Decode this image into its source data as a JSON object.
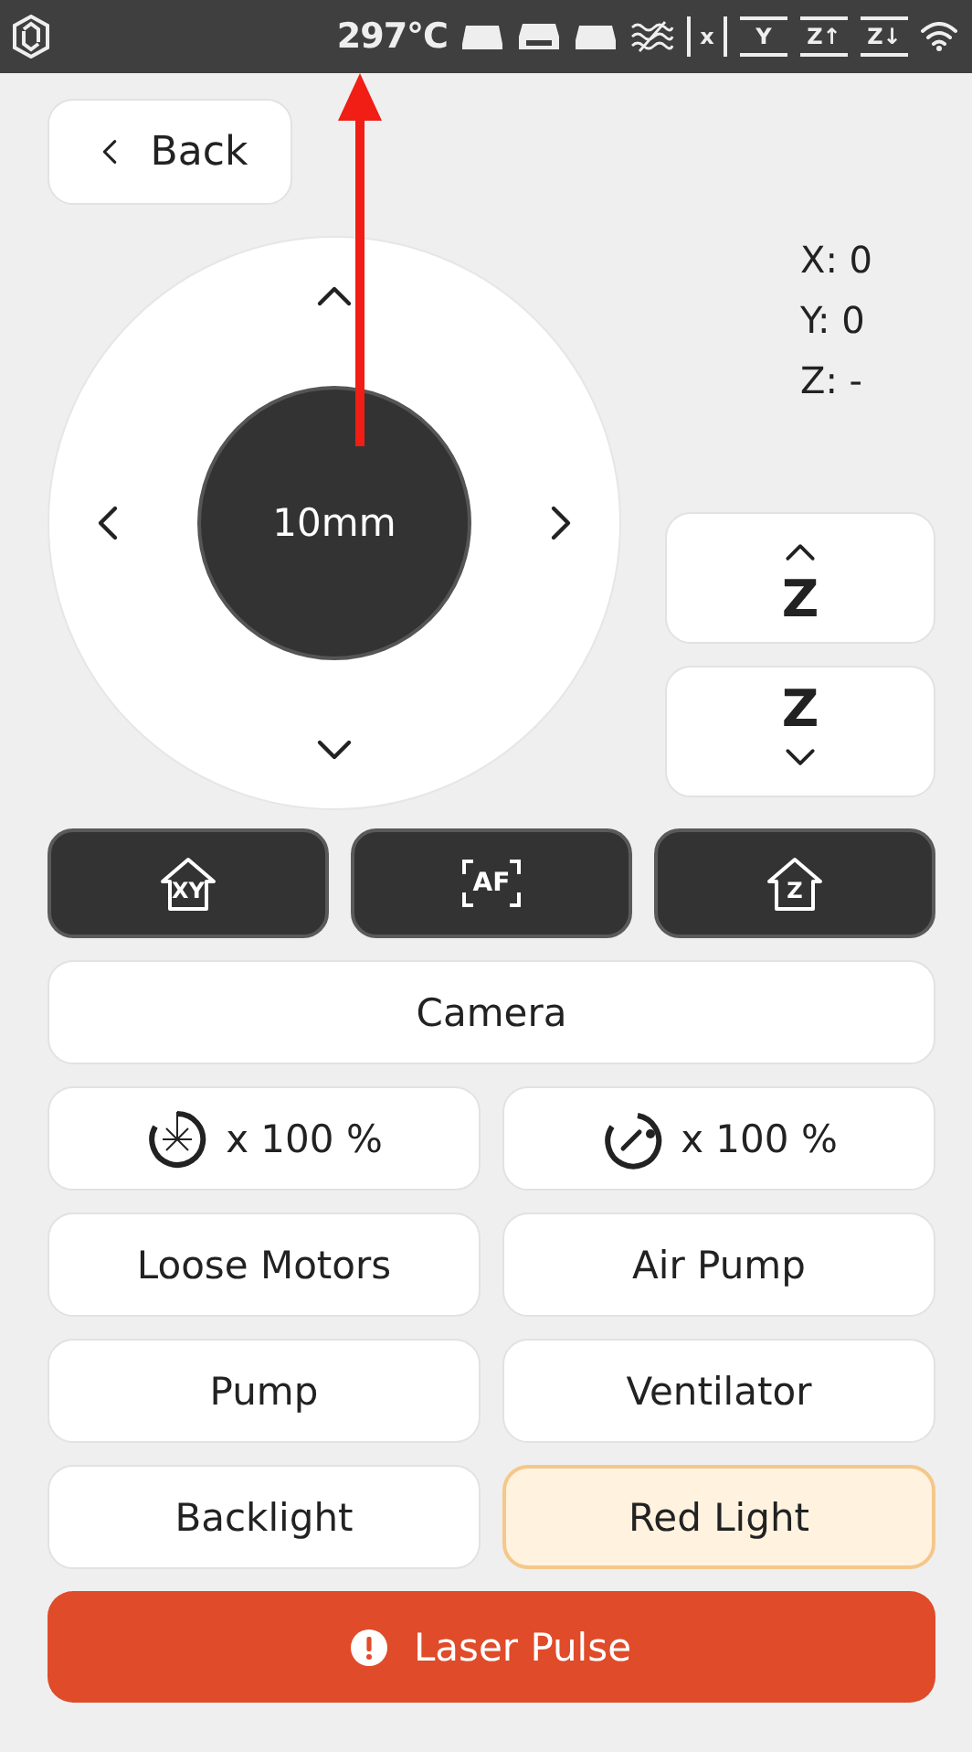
{
  "status_bar": {
    "temperature": "297°C",
    "axis_indicators": [
      {
        "label": "x",
        "kind": "bars"
      },
      {
        "label": "Y",
        "kind": "lines"
      },
      {
        "label": "Z↑",
        "kind": "lines"
      },
      {
        "label": "Z↓",
        "kind": "lines"
      }
    ]
  },
  "back_button": {
    "label": "Back"
  },
  "jog": {
    "step": "10mm"
  },
  "coordinates": [
    "X: 0",
    "Y: 0",
    "Z: -"
  ],
  "z_buttons": [
    {
      "label": "Z",
      "kind": "up"
    },
    {
      "label": "Z",
      "kind": "down"
    }
  ],
  "home_buttons": [
    {
      "kind": "home",
      "label": "XY"
    },
    {
      "kind": "autofocus",
      "label": "AF"
    },
    {
      "kind": "home",
      "label": "Z"
    }
  ],
  "camera_button": {
    "label": "Camera"
  },
  "overrides": [
    {
      "kind": "laser",
      "value": "x 100 %"
    },
    {
      "kind": "speed",
      "value": "x 100 %"
    }
  ],
  "toggles": [
    {
      "label": "Loose Motors",
      "on": false
    },
    {
      "label": "Air Pump",
      "on": false
    },
    {
      "label": "Pump",
      "on": false
    },
    {
      "label": "Ventilator",
      "on": false
    },
    {
      "label": "Backlight",
      "on": false
    },
    {
      "label": "Red Light",
      "on": true
    }
  ],
  "laser_pulse_button": {
    "label": "Laser Pulse"
  }
}
